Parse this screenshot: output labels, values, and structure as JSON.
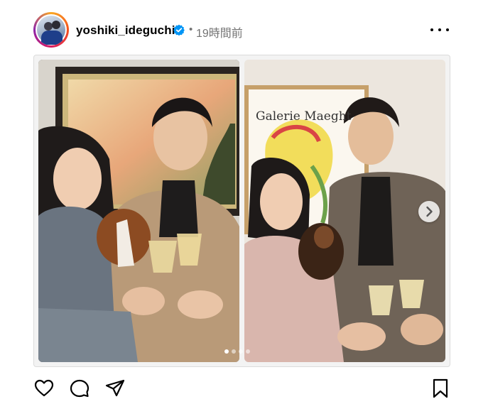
{
  "post": {
    "username": "yoshiki_ideguchi",
    "separator": "•",
    "time_ago": "19時間前",
    "verified": true,
    "more_icon": "more-horizontal-icon"
  },
  "media": {
    "left_photo": {
      "description_icon": "photo"
    },
    "right_photo": {
      "poster_text": "Galerie Maeght"
    },
    "carousel": {
      "next_icon": "chevron-right-icon",
      "total_slides": 4,
      "active_slide": 1
    }
  },
  "actions": {
    "like_icon": "heart-icon",
    "comment_icon": "comment-icon",
    "share_icon": "send-icon",
    "save_icon": "bookmark-icon"
  },
  "colors": {
    "verified_blue": "#0095f6",
    "secondary_text": "#737373",
    "border": "#dbdbdb"
  }
}
